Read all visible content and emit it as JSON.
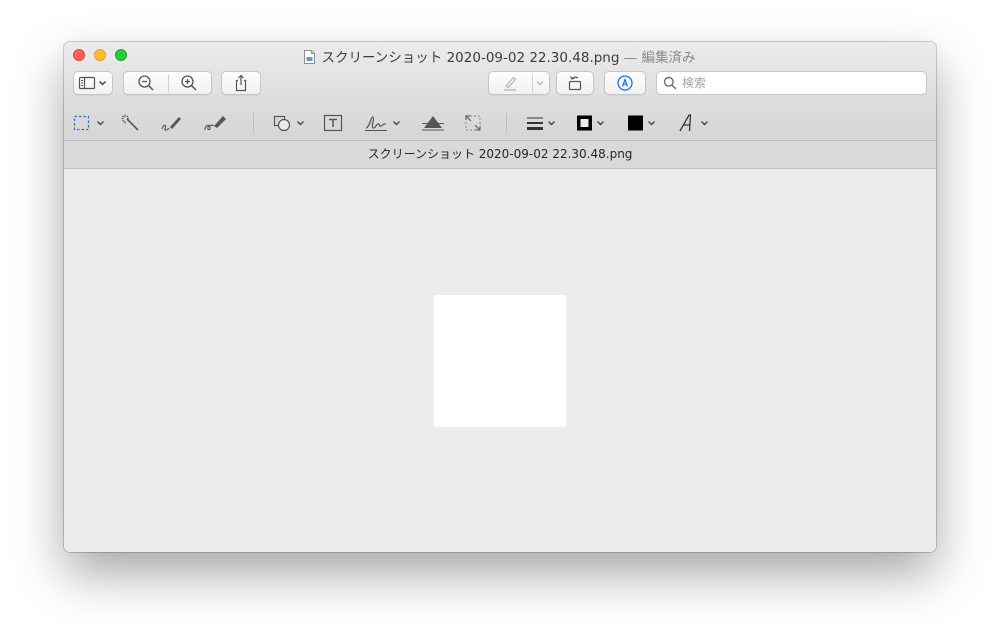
{
  "window": {
    "title_filename": "スクリーンショット 2020-09-02 22.30.48.png",
    "title_status": "— 編集済み"
  },
  "toolbar": {
    "sidebar_button": "sidebar-toggle",
    "zoom_out": "zoom-out",
    "zoom_in": "zoom-in",
    "share": "share",
    "highlight": "highlight",
    "rotate": "rotate",
    "markup": "markup"
  },
  "search": {
    "placeholder": "検索"
  },
  "markup_tools": [
    "rectangular-selection",
    "instant-alpha",
    "sketch",
    "draw",
    "shapes",
    "text",
    "sign",
    "adjust-color",
    "adjust-size",
    "shape-style",
    "border-color",
    "fill-color",
    "text-style"
  ],
  "tab": {
    "label": "スクリーンショット 2020-09-02 22.30.48.png"
  },
  "colors": {
    "close": "#fe5f57",
    "minimize": "#febc2e",
    "maximize": "#28c840",
    "selection_accent": "#2b6fd6",
    "markup_accent": "#1b6fe0",
    "canvas": "#ececec",
    "image": "#ffffff"
  }
}
